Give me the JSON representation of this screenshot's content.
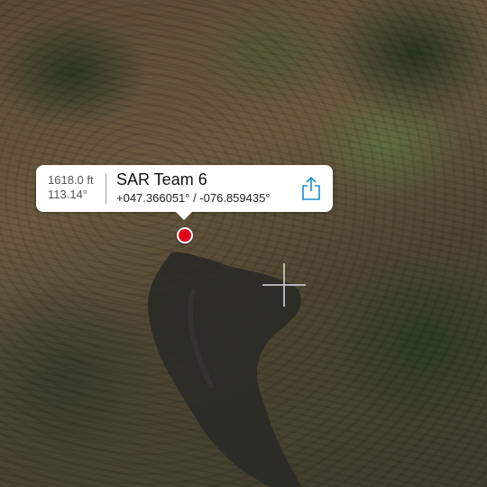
{
  "callout": {
    "distance": "1618.0 ft",
    "bearing": "113.14°",
    "title": "SAR Team 6",
    "coordinates": "+047.366051° / -076.859435°"
  },
  "icons": {
    "share": "share-icon",
    "pin": "location-pin-icon",
    "crosshair": "crosshair-icon"
  },
  "colors": {
    "accent": "#1a8ad4",
    "pin": "#e3001b"
  }
}
